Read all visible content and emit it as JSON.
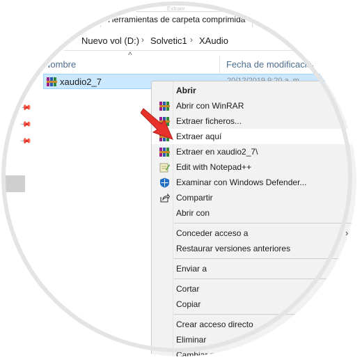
{
  "ribbon": {
    "tab_label": "Herramientas de carpeta comprimida",
    "tab_top_label": "Extraer"
  },
  "address": {
    "crumbs": [
      "Nuevo vol (D:)",
      "Solvetic1",
      "XAudio"
    ]
  },
  "columns": {
    "name": "Nombre",
    "date": "Fecha de modificación"
  },
  "file": {
    "name": "xaudio2_7",
    "date": "20/12/2019 9:20 a. m.",
    "icon": "winrar-archive-icon"
  },
  "context_menu": {
    "items": [
      {
        "label": "Abrir",
        "bold": true,
        "icon": "none"
      },
      {
        "label": "Abrir con WinRAR",
        "icon": "winrar-icon"
      },
      {
        "label": "Extraer ficheros...",
        "icon": "winrar-icon"
      },
      {
        "label": "Extraer aquí",
        "icon": "winrar-icon",
        "highlighted": true
      },
      {
        "label": "Extraer en xaudio2_7\\",
        "icon": "winrar-icon"
      },
      {
        "label": "Edit with Notepad++",
        "icon": "notepad-plus-plus-icon"
      },
      {
        "label": "Examinar con Windows Defender...",
        "icon": "windows-defender-icon"
      },
      {
        "label": "Compartir",
        "icon": "share-icon"
      },
      {
        "label": "Abrir con",
        "icon": "none",
        "submenu": true
      },
      {
        "label": "Conceder acceso a",
        "icon": "none",
        "submenu": true
      },
      {
        "label": "Restaurar versiones anteriores",
        "icon": "none"
      },
      {
        "label": "Enviar a",
        "icon": "none",
        "submenu": true
      },
      {
        "label": "Cortar",
        "icon": "none"
      },
      {
        "label": "Copiar",
        "icon": "none"
      },
      {
        "label": "Crear acceso directo",
        "icon": "none"
      },
      {
        "label": "Eliminar",
        "icon": "none"
      },
      {
        "label": "Cambiar nombre",
        "icon": "none"
      }
    ]
  },
  "colors": {
    "selection": "#cce8ff",
    "menu_bg": "#f2f2f2",
    "arrow": "#e8312a"
  }
}
